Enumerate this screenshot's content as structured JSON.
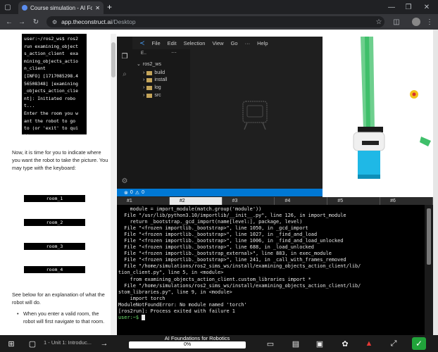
{
  "browser": {
    "tab_title": "Course simulation - AI Foun",
    "new_tab": "+",
    "url_host": "app.theconstruct.ai",
    "url_path": "/Desktop"
  },
  "lesson": {
    "terminal_snippet": "user:~/ros2_ws$ ros2\nrun examining_object\ns_action_client  exa\nmining_objects_actio\nn_client\n[INFO] [1717085298.4\n56508348] [examining\n_objects_action_clie\nnt]: Initiated robo\nt...\nEnter the room you w\nant the robot to go\nto (or 'exit' to qui\nt):",
    "intro_text": "Now, it is time for you to indicate where you want the robot to take the picture. You may type with the keyboard:",
    "rooms": [
      "room_1",
      "room_2",
      "room_3",
      "room_4"
    ],
    "see_below": "See below for an explanation of what the robot will do.",
    "bullet_1": "When you enter a valid room, the robot will first navigate to that room."
  },
  "vscode": {
    "menu": [
      "File",
      "Edit",
      "Selection",
      "View",
      "Go",
      "Help"
    ],
    "explorer_title": "E..",
    "root_folder": "ros2_ws",
    "folders": [
      "build",
      "install",
      "log",
      "src"
    ],
    "status_errors": "0",
    "status_warnings": "0"
  },
  "terminal_tabs": [
    "#1",
    "#2",
    "#3",
    "#4",
    "#5",
    "#6"
  ],
  "terminal_lines": [
    "    module = import_module(match.group('module'))",
    "  File \"/usr/lib/python3.10/importlib/__init__.py\", line 126, in import_module",
    "    return _bootstrap._gcd_import(name[level:], package, level)",
    "  File \"<frozen importlib._bootstrap>\", line 1050, in _gcd_import",
    "  File \"<frozen importlib._bootstrap>\", line 1027, in _find_and_load",
    "  File \"<frozen importlib._bootstrap>\", line 1006, in _find_and_load_unlocked",
    "  File \"<frozen importlib._bootstrap>\", line 688, in _load_unlocked",
    "  File \"<frozen importlib._bootstrap_external>\", line 883, in exec_module",
    "  File \"<frozen importlib._bootstrap>\", line 241, in _call_with_frames_removed",
    "  File \"/home/simulations/ros2_sims_ws/install/examining_objects_action_client/lib/",
    "tion_client.py\", line 5, in <module>",
    "    from examining_objects_action_client.custom_libraries import *",
    "  File \"/home/simulations/ros2_sims_ws/install/examining_objects_action_client/lib/",
    "stom_libraries.py\", line 9, in <module>",
    "    import torch",
    "ModuleNotFoundError: No module named 'torch'",
    "[ros2run]: Process exited with failure 1"
  ],
  "terminal_prompt": "user:~$ ",
  "bottom": {
    "unit_label": "1 - Unit 1: Introduc...",
    "course_title": "AI Foundations for Robotics",
    "progress_text": "0%",
    "progress_value": 0
  }
}
